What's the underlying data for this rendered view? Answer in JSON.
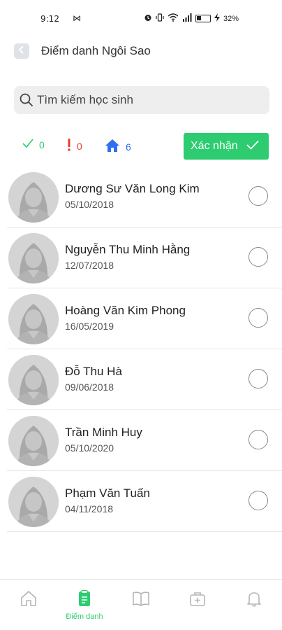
{
  "status_bar": {
    "time": "9:12",
    "mail_glyph": "⋈",
    "battery_text": "32%"
  },
  "header": {
    "title": "Điểm danh Ngôi Sao",
    "back_icon": "chevron-left-icon"
  },
  "search": {
    "placeholder": "Tìm kiếm học sinh"
  },
  "summary": {
    "present_count": "0",
    "absent_count": "0",
    "home_count": "6",
    "confirm_label": "Xác nhận"
  },
  "students": [
    {
      "name": "Dương Sư Văn Long Kim",
      "dob": "05/10/2018"
    },
    {
      "name": "Nguyễn Thu Minh Hằng",
      "dob": "12/07/2018"
    },
    {
      "name": "Hoàng Văn Kim Phong",
      "dob": "16/05/2019"
    },
    {
      "name": "Đỗ Thu Hà",
      "dob": "09/06/2018"
    },
    {
      "name": "Trần Minh Huy",
      "dob": "05/10/2020"
    },
    {
      "name": "Phạm Văn Tuấn",
      "dob": "04/11/2018"
    }
  ],
  "bottom_nav": {
    "active_label": "Điểm danh"
  },
  "colors": {
    "accent_green": "#2ecc71",
    "absent_red": "#e53935",
    "home_blue": "#2f6ff2"
  }
}
